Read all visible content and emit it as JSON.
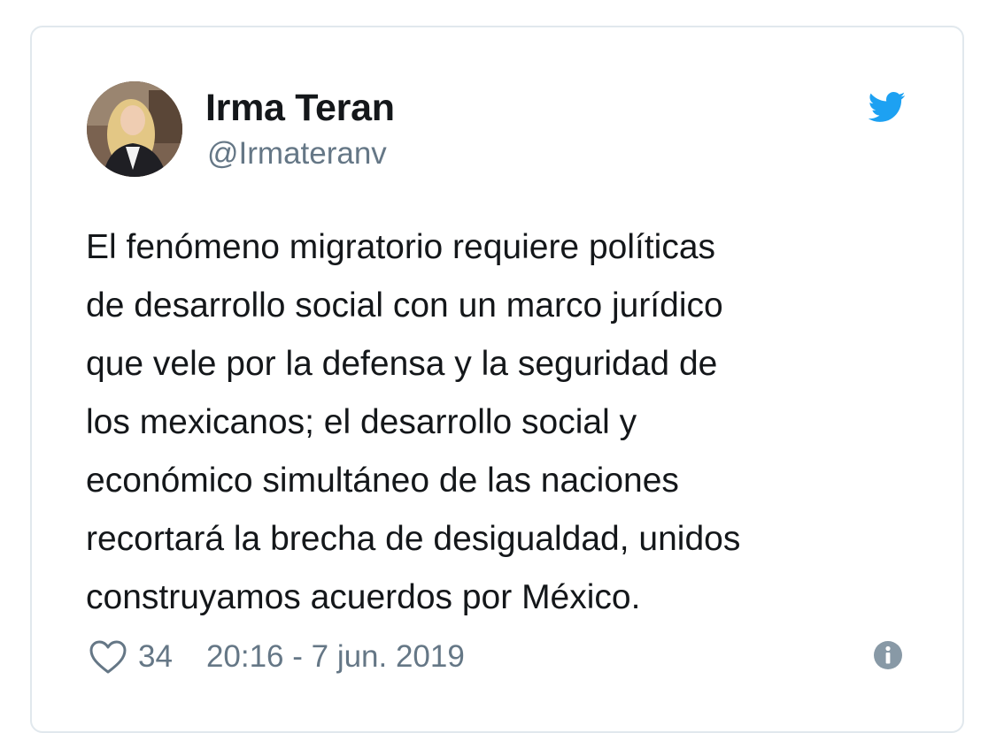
{
  "tweet": {
    "author": {
      "name": "Irma Teran",
      "handle": "@Irmateranv"
    },
    "text_lines": [
      "El fenómeno migratorio requiere políticas",
      "de desarrollo social con un marco jurídico",
      "que vele por la defensa y la seguridad de",
      "los mexicanos; el desarrollo social y",
      "económico simultáneo de las naciones",
      "recortará la brecha de desigualdad, unidos",
      "construyamos acuerdos por México."
    ],
    "likes": "34",
    "timestamp": "20:16 - 7 jun. 2019"
  },
  "icons": {
    "brand": "twitter-bird-icon",
    "like": "heart-icon",
    "info": "info-icon"
  },
  "colors": {
    "twitter_blue": "#1da1f2",
    "text_primary": "#14171a",
    "text_secondary": "#657786",
    "border": "#e1e8ed"
  }
}
